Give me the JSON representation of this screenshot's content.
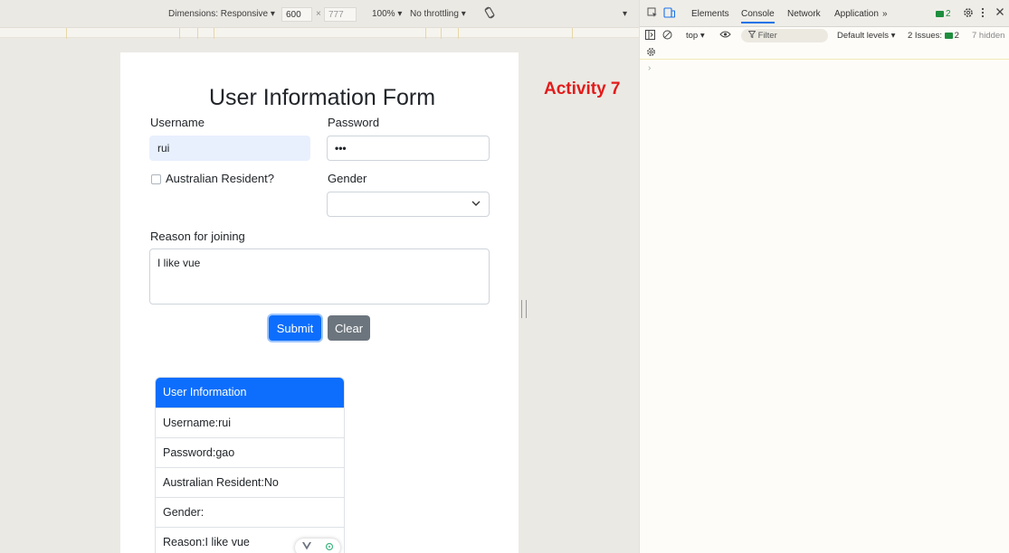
{
  "device_toolbar": {
    "dimensions_label": "Dimensions: Responsive ▾",
    "width_value": "600",
    "height_value": "777",
    "times": "×",
    "zoom": "100% ▾",
    "throttling": "No throttling ▾",
    "rotate_icon": "rotate-icon",
    "more": "▾"
  },
  "form": {
    "title": "User Information Form",
    "username_label": "Username",
    "username_value": "rui",
    "password_label": "Password",
    "password_value": "•••",
    "resident_label": "Australian Resident?",
    "gender_label": "Gender",
    "gender_value": "",
    "reason_label": "Reason for joining",
    "reason_value": "I like vue",
    "submit_label": "Submit",
    "clear_label": "Clear"
  },
  "info_card": {
    "header": "User Information",
    "rows": [
      "Username:rui",
      "Password:gao",
      "Australian Resident:No",
      "Gender:",
      "Reason:I like vue"
    ]
  },
  "activity_label": "Activity 7",
  "devtools": {
    "tabs": [
      "Elements",
      "Console",
      "Network",
      "Application",
      "»"
    ],
    "active_tab": "Console",
    "message_count": "2",
    "console_bar": {
      "context": "top ▾",
      "filter_placeholder": "Filter",
      "levels": "Default levels ▾",
      "issues_text": "2 Issues:",
      "issues_count": "2",
      "hidden": "7 hidden"
    },
    "prompt": "›"
  },
  "colors": {
    "primary": "#0d6efd",
    "secondary": "#6c757d",
    "activity": "#e21b1b"
  }
}
